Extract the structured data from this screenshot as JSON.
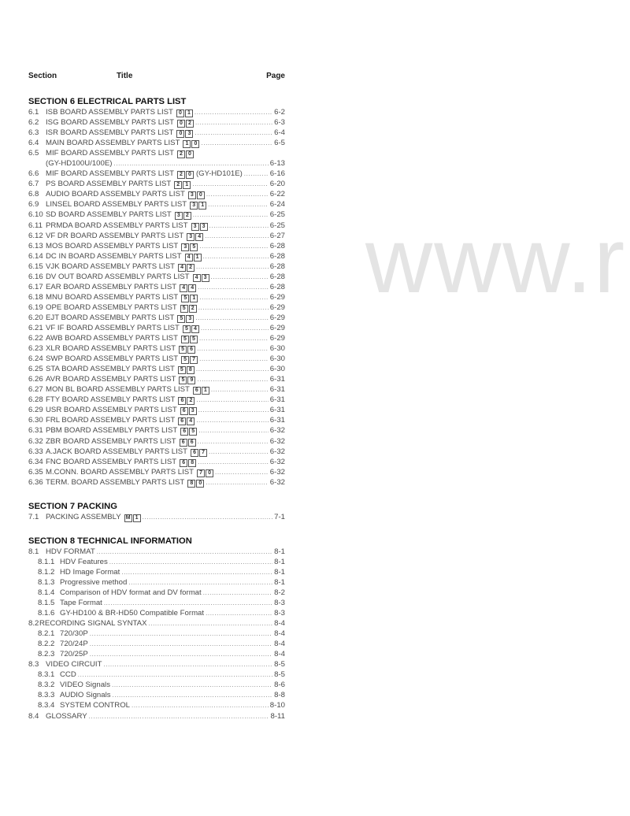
{
  "watermark": "www.ra",
  "header": {
    "section": "Section",
    "title": "Title",
    "page": "Page"
  },
  "sections": [
    {
      "heading": "SECTION 6 ELECTRICAL PARTS LIST",
      "entries": [
        {
          "num": "6.1",
          "title": "ISB BOARD ASSEMBLY PARTS LIST",
          "boxes": [
            "0",
            "1"
          ],
          "page": "6-2"
        },
        {
          "num": "6.2",
          "title": "ISG BOARD ASSEMBLY PARTS LIST",
          "boxes": [
            "0",
            "2"
          ],
          "page": "6-3"
        },
        {
          "num": "6.3",
          "title": "ISR BOARD ASSEMBLY PARTS LIST",
          "boxes": [
            "0",
            "3"
          ],
          "page": "6-4"
        },
        {
          "num": "6.4",
          "title": "MAIN BOARD ASSEMBLY PARTS LIST",
          "boxes": [
            "1",
            "0"
          ],
          "page": "6-5"
        },
        {
          "num": "6.5",
          "title": "MIF BOARD ASSEMBLY PARTS LIST",
          "boxes": [
            "2",
            "0"
          ],
          "page": "",
          "continuation": "(GY-HD100U/100E)",
          "continuation_page": "6-13"
        },
        {
          "num": "6.6",
          "title": "MIF BOARD ASSEMBLY PARTS LIST",
          "boxes": [
            "2",
            "0"
          ],
          "suffix": "(GY-HD101E)",
          "page": "6-16"
        },
        {
          "num": "6.7",
          "title": "PS BOARD ASSEMBLY PARTS LIST",
          "boxes": [
            "2",
            "1"
          ],
          "page": "6-20"
        },
        {
          "num": "6.8",
          "title": "AUDIO BOARD ASSEMBLY PARTS LIST",
          "boxes": [
            "3",
            "0"
          ],
          "page": "6-22"
        },
        {
          "num": "6.9",
          "title": "LINSEL BOARD ASSEMBLY PARTS LIST",
          "boxes": [
            "3",
            "1"
          ],
          "page": "6-24"
        },
        {
          "num": "6.10",
          "title": "SD BOARD ASSEMBLY PARTS LIST",
          "boxes": [
            "3",
            "2"
          ],
          "page": "6-25"
        },
        {
          "num": "6.11",
          "title": "PRMDA BOARD ASSEMBLY PARTS LIST",
          "boxes": [
            "3",
            "3"
          ],
          "page": "6-25"
        },
        {
          "num": "6.12",
          "title": "VF DR BOARD ASSEMBLY PARTS LIST",
          "boxes": [
            "3",
            "4"
          ],
          "page": "6-27"
        },
        {
          "num": "6.13",
          "title": "MOS BOARD ASSEMBLY PARTS LIST",
          "boxes": [
            "3",
            "5"
          ],
          "page": "6-28"
        },
        {
          "num": "6.14",
          "title": "DC IN BOARD ASSEMBLY PARTS LIST",
          "boxes": [
            "4",
            "1"
          ],
          "page": "6-28"
        },
        {
          "num": "6.15",
          "title": "VJK BOARD ASSEMBLY PARTS LIST",
          "boxes": [
            "4",
            "2"
          ],
          "page": "6-28"
        },
        {
          "num": "6.16",
          "title": "DV OUT BOARD ASSEMBLY PARTS LIST",
          "boxes": [
            "4",
            "3"
          ],
          "page": "6-28"
        },
        {
          "num": "6.17",
          "title": "EAR BOARD ASSEMBLY PARTS LIST",
          "boxes": [
            "4",
            "4"
          ],
          "page": "6-28"
        },
        {
          "num": "6.18",
          "title": "MNU BOARD ASSEMBLY PARTS LIST",
          "boxes": [
            "5",
            "1"
          ],
          "page": "6-29"
        },
        {
          "num": "6.19",
          "title": "OPE BOARD ASSEMBLY PARTS LIST",
          "boxes": [
            "5",
            "2"
          ],
          "page": "6-29"
        },
        {
          "num": "6.20",
          "title": "EJT BOARD ASSEMBLY PARTS LIST",
          "boxes": [
            "5",
            "3"
          ],
          "page": "6-29"
        },
        {
          "num": "6.21",
          "title": "VF IF BOARD ASSEMBLY PARTS LIST",
          "boxes": [
            "5",
            "4"
          ],
          "page": "6-29"
        },
        {
          "num": "6.22",
          "title": "AWB BOARD ASSEMBLY PARTS LIST",
          "boxes": [
            "5",
            "5"
          ],
          "page": "6-29"
        },
        {
          "num": "6.23",
          "title": "XLR BOARD ASSEMBLY PARTS LIST",
          "boxes": [
            "5",
            "6"
          ],
          "page": "6-30"
        },
        {
          "num": "6.24",
          "title": "SWP BOARD ASSEMBLY PARTS LIST",
          "boxes": [
            "5",
            "7"
          ],
          "page": "6-30"
        },
        {
          "num": "6.25",
          "title": "STA BOARD ASSEMBLY PARTS LIST",
          "boxes": [
            "5",
            "8"
          ],
          "page": "6-30"
        },
        {
          "num": "6.26",
          "title": "AVR BOARD ASSEMBLY PARTS LIST",
          "boxes": [
            "5",
            "9"
          ],
          "page": "6-31"
        },
        {
          "num": "6.27",
          "title": "MON BL BOARD ASSEMBLY PARTS LIST",
          "boxes": [
            "6",
            "1"
          ],
          "page": "6-31"
        },
        {
          "num": "6.28",
          "title": "FTY BOARD ASSEMBLY PARTS LIST",
          "boxes": [
            "6",
            "2"
          ],
          "page": "6-31"
        },
        {
          "num": "6.29",
          "title": "USR BOARD ASSEMBLY PARTS LIST",
          "boxes": [
            "6",
            "3"
          ],
          "page": "6-31"
        },
        {
          "num": "6.30",
          "title": "FRL BOARD ASSEMBLY PARTS LIST",
          "boxes": [
            "6",
            "4"
          ],
          "page": "6-31"
        },
        {
          "num": "6.31",
          "title": "PBM BOARD ASSEMBLY PARTS LIST",
          "boxes": [
            "6",
            "5"
          ],
          "page": "6-32"
        },
        {
          "num": "6.32",
          "title": "ZBR BOARD ASSEMBLY PARTS LIST",
          "boxes": [
            "6",
            "6"
          ],
          "page": "6-32"
        },
        {
          "num": "6.33",
          "title": "A.JACK BOARD ASSEMBLY PARTS LIST",
          "boxes": [
            "6",
            "7"
          ],
          "page": "6-32"
        },
        {
          "num": "6.34",
          "title": "FNC BOARD ASSEMBLY PARTS LIST",
          "boxes": [
            "6",
            "8"
          ],
          "page": "6-32"
        },
        {
          "num": "6.35",
          "title": "M.CONN. BOARD ASSEMBLY PARTS LIST",
          "boxes": [
            "7",
            "0"
          ],
          "page": "6-32"
        },
        {
          "num": "6.36",
          "title": "TERM. BOARD ASSEMBLY PARTS LIST",
          "boxes": [
            "8",
            "0"
          ],
          "page": "6-32"
        }
      ]
    },
    {
      "heading": "SECTION 7 PACKING",
      "entries": [
        {
          "num": "7.1",
          "title": "PACKING ASSEMBLY",
          "boxes": [
            "M",
            "1"
          ],
          "page": "7-1"
        }
      ]
    },
    {
      "heading": "SECTION 8 TECHNICAL INFORMATION",
      "entries": [
        {
          "num": "8.1",
          "title": "HDV FORMAT",
          "page": "8-1",
          "level": 1
        },
        {
          "num": "8.1.1",
          "title": "HDV Features",
          "page": "8-1",
          "level": 2
        },
        {
          "num": "8.1.2",
          "title": "HD Image Format",
          "page": "8-1",
          "level": 2
        },
        {
          "num": "8.1.3",
          "title": "Progressive method",
          "page": "8-1",
          "level": 2
        },
        {
          "num": "8.1.4",
          "title": "Comparison of HDV format and DV format",
          "page": "8-2",
          "level": 2
        },
        {
          "num": "8.1.5",
          "title": "Tape Format",
          "page": "8-3",
          "level": 2
        },
        {
          "num": "8.1.6",
          "title": "GY-HD100 & BR-HD50 Compatible Format",
          "page": "8-3",
          "level": 2
        },
        {
          "num": "8.2",
          "title": "RECORDING SIGNAL SYNTAX",
          "page": "8-4",
          "level": 1,
          "tight": true
        },
        {
          "num": "8.2.1",
          "title": "720/30P",
          "page": "8-4",
          "level": 2
        },
        {
          "num": "8.2.2",
          "title": "720/24P",
          "page": "8-4",
          "level": 2
        },
        {
          "num": "8.2.3",
          "title": "720/25P",
          "page": "8-4",
          "level": 2
        },
        {
          "num": "8.3",
          "title": "VIDEO CIRCUIT",
          "page": "8-5",
          "level": 1
        },
        {
          "num": "8.3.1",
          "title": "CCD",
          "page": "8-5",
          "level": 2
        },
        {
          "num": "8.3.2",
          "title": "VIDEO Signals",
          "page": "8-6",
          "level": 2
        },
        {
          "num": "8.3.3",
          "title": "AUDIO Signals",
          "page": "8-8",
          "level": 2
        },
        {
          "num": "8.3.4",
          "title": "SYSTEM CONTROL",
          "page": "8-10",
          "level": 2
        },
        {
          "num": "8.4",
          "title": "GLOSSARY",
          "page": "8-11",
          "level": 1
        }
      ]
    }
  ]
}
